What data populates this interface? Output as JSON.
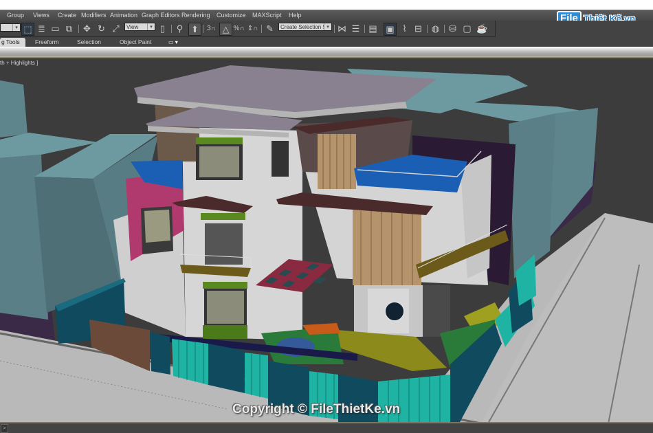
{
  "menubar": {
    "items": [
      "Group",
      "Views",
      "Create",
      "Modifiers",
      "Animation",
      "Graph Editors",
      "Rendering",
      "Customize",
      "MAXScript",
      "Help"
    ]
  },
  "toolbar": {
    "reference_coord_dropdown": "View",
    "named_selection_dropdown": "Create Selection Se",
    "icons": [
      "selection-filter-dropdown",
      "select-object-icon",
      "select-by-name-icon",
      "rectangular-selection-icon",
      "window-crossing-icon",
      "select-move-icon",
      "select-rotate-icon",
      "select-scale-icon",
      "use-pivot-icon",
      "select-manipulate-icon",
      "keyboard-shortcut-override-icon",
      "snaps-toggle-icon",
      "angle-snap-icon",
      "percent-snap-icon",
      "spinner-snap-icon",
      "edit-named-selection-icon",
      "mirror-icon",
      "align-icon",
      "layer-manager-icon",
      "scene-explorer-icon",
      "curve-editor-icon",
      "schematic-view-icon",
      "material-editor-icon",
      "render-setup-icon",
      "rendered-frame-window-icon",
      "render-production-icon"
    ]
  },
  "logo": {
    "file": "File",
    "rest": "Thiết Kế.vn"
  },
  "ribbon": {
    "tabs": [
      "Modeling Tools",
      "Freeform",
      "Selection",
      "Object Paint"
    ],
    "selected_tab_visible": "g Tools",
    "extra_button": "ribbon-options-button"
  },
  "viewport": {
    "label": "th + Highlights ]",
    "watermark": "Copyright © FileThietKe.vn"
  },
  "statusbar": {
    "script_button": ">"
  },
  "colors": {
    "menubar": "#4e4e4e",
    "toolbar": "#434343",
    "viewport_bg": "#3c3c3c",
    "accent_logo": "#2f8bd1",
    "building_teal": "#5e858c",
    "roof": "#8a8190",
    "wall_white": "#d2d2d2",
    "pool_blue": "#1a5fb4",
    "fence_cyan": "#1fb3a3",
    "wall_dark_teal": "#0f4a5e"
  }
}
